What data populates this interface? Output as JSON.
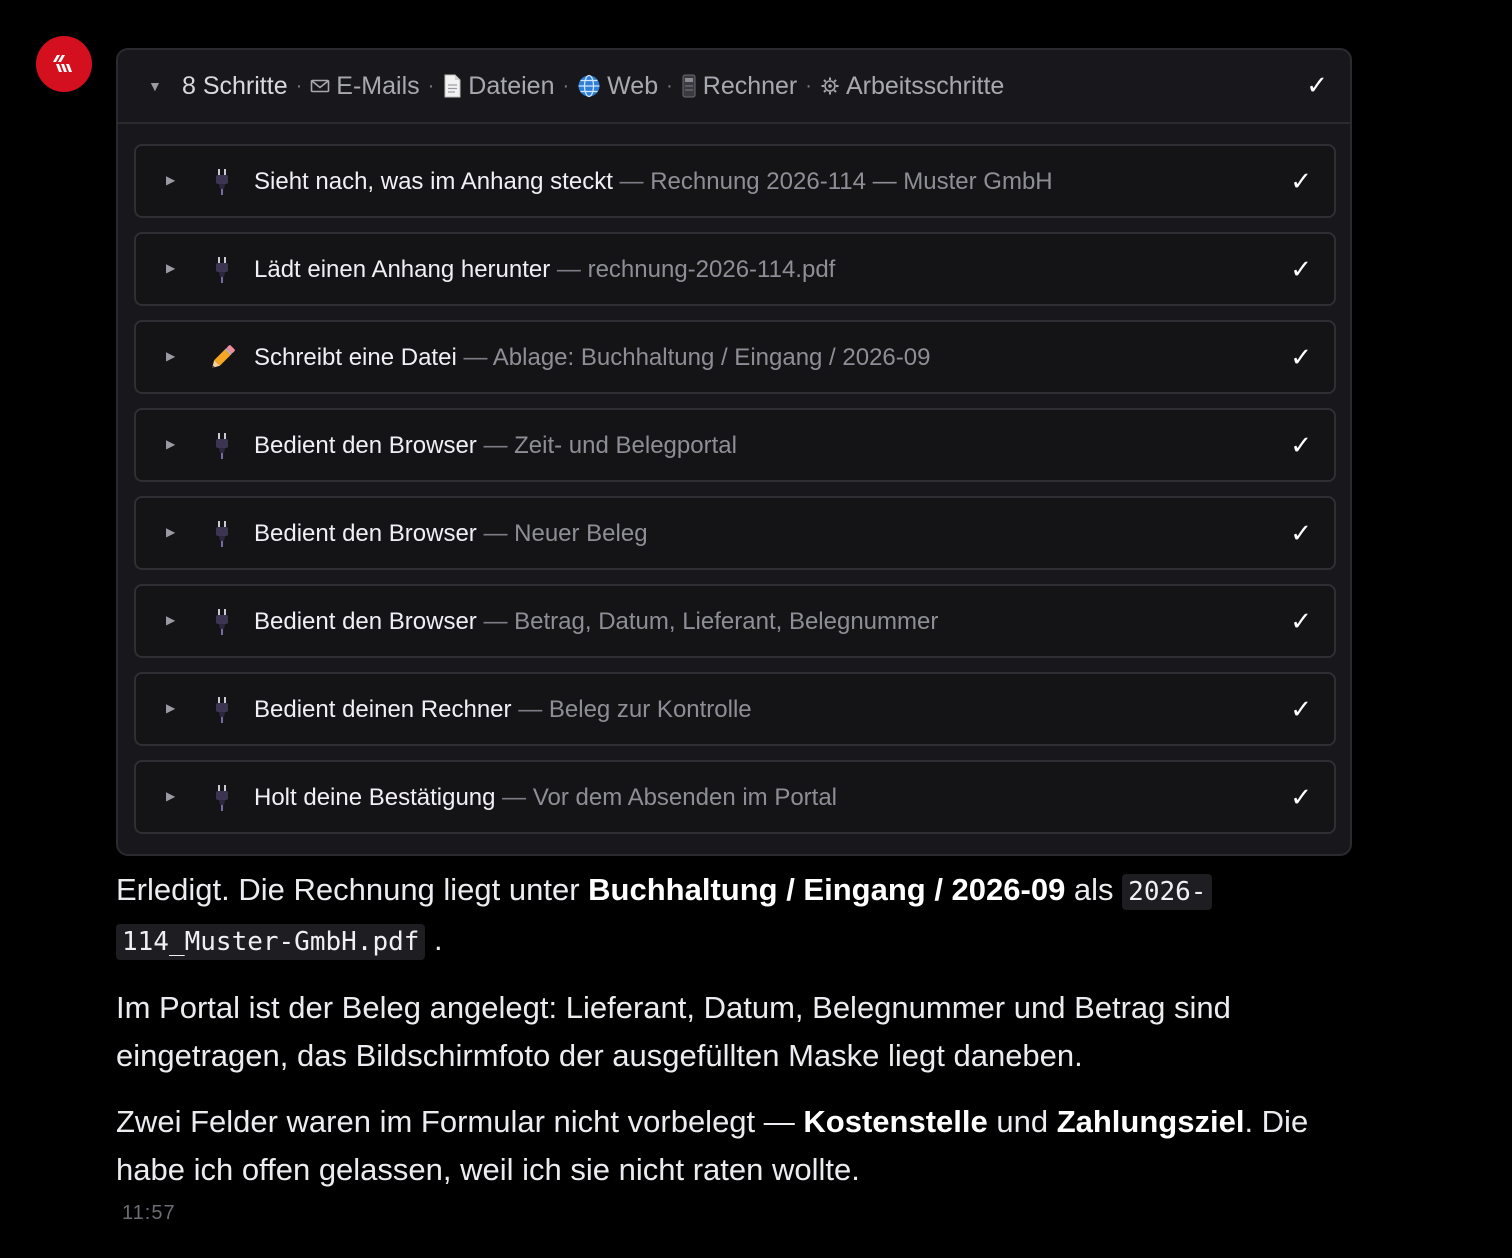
{
  "colors": {
    "background": "#000000",
    "panel": "#18181c",
    "avatar": "#d4101f",
    "check": "#ffffff"
  },
  "header": {
    "steps_label": "8 Schritte",
    "items": [
      {
        "icon": "envelope-icon",
        "label": "E-Mails"
      },
      {
        "icon": "document-icon",
        "label": "Dateien"
      },
      {
        "icon": "globe-icon",
        "label": "Web"
      },
      {
        "icon": "computer-icon",
        "label": "Rechner"
      },
      {
        "icon": "gear-icon",
        "label": "Arbeitsschritte"
      }
    ],
    "check": "✓"
  },
  "steps": [
    {
      "icon": "plug-icon",
      "title": "Sieht nach, was im Anhang steckt",
      "detail": "Rechnung 2026-114 — Muster GmbH",
      "check": "✓"
    },
    {
      "icon": "plug-icon",
      "title": "Lädt einen Anhang herunter",
      "detail": "rechnung-2026-114.pdf",
      "check": "✓"
    },
    {
      "icon": "pencil-icon",
      "title": "Schreibt eine Datei",
      "detail": "Ablage: Buchhaltung / Eingang / 2026-09",
      "check": "✓"
    },
    {
      "icon": "plug-icon",
      "title": "Bedient den Browser",
      "detail": "Zeit- und Belegportal",
      "check": "✓"
    },
    {
      "icon": "plug-icon",
      "title": "Bedient den Browser",
      "detail": "Neuer Beleg",
      "check": "✓"
    },
    {
      "icon": "plug-icon",
      "title": "Bedient den Browser",
      "detail": "Betrag, Datum, Lieferant, Belegnummer",
      "check": "✓"
    },
    {
      "icon": "plug-icon",
      "title": "Bedient deinen Rechner",
      "detail": "Beleg zur Kontrolle",
      "check": "✓"
    },
    {
      "icon": "plug-icon",
      "title": "Holt deine Bestätigung",
      "detail": "Vor dem Absenden im Portal",
      "check": "✓"
    }
  ],
  "message": {
    "p1": {
      "t1": "Erledigt. Die Rechnung liegt unter ",
      "b1": "Buchhaltung / Eingang / 2026-09",
      "t2": " als ",
      "code1": "2026-",
      "code2": "114_Muster-GmbH.pdf",
      "t3": " ."
    },
    "p2": "Im Portal ist der Beleg angelegt: Lieferant, Datum, Belegnummer und Betrag sind eingetragen, das Bildschirmfoto der ausgefüllten Maske liegt daneben.",
    "p3": {
      "t1": "Zwei Felder waren im Formular nicht vorbelegt — ",
      "b1": "Kostenstelle",
      "t2": " und ",
      "b2": "Zahlungsziel",
      "t3": ". Die habe ich offen gelassen, weil ich sie nicht raten wollte."
    }
  },
  "timestamp": "11:57"
}
